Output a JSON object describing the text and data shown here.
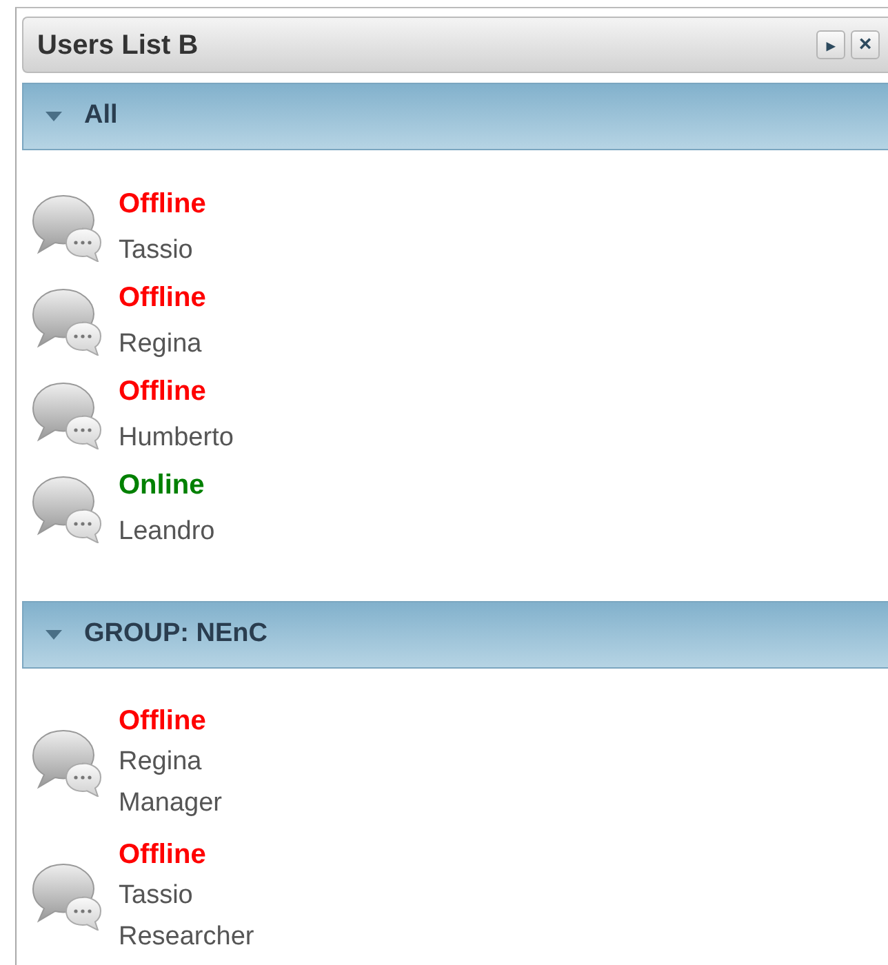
{
  "panel": {
    "title": "Users List B",
    "buttons": [
      {
        "kind": "expand",
        "label": "▸"
      },
      {
        "kind": "close",
        "label": "×"
      }
    ]
  },
  "groups": [
    {
      "title": "All",
      "expanded": true,
      "users": [
        {
          "status": "Offline",
          "online": false,
          "name": "Tassio"
        },
        {
          "status": "Offline",
          "online": false,
          "name": "Regina"
        },
        {
          "status": "Offline",
          "online": false,
          "name": "Humberto"
        },
        {
          "status": "Online",
          "online": true,
          "name": "Leandro"
        }
      ]
    },
    {
      "title": "GROUP: NEnC",
      "expanded": true,
      "users": [
        {
          "status": "Offline",
          "online": false,
          "name": "Regina",
          "role": "Manager"
        },
        {
          "status": "Offline",
          "online": false,
          "name": "Tassio",
          "role": "Researcher"
        }
      ]
    }
  ]
}
